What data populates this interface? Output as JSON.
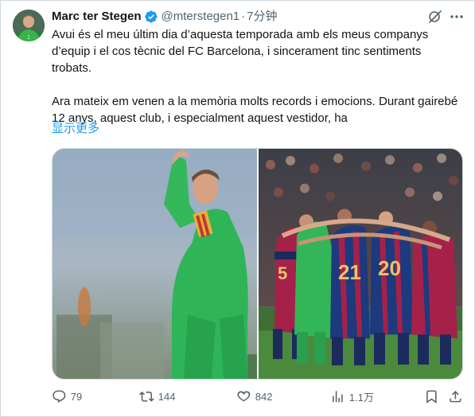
{
  "author": {
    "display_name": "Marc ter Stegen",
    "handle": "@mterstegen1",
    "separator": "·",
    "time": "7分钟",
    "verified": true
  },
  "tweet": {
    "paragraph1": "Avui és el meu últim dia d’aquesta temporada amb els meus companys d’equip i el cos tècnic del FC Barcelona, i sincerament tinc sentiments trobats.",
    "paragraph2": "Ara mateix em venen a la memòria molts records i emocions. Durant gairebé 12 anys, aquest club, i especialment aquest vestidor, ha",
    "show_more": "显示更多"
  },
  "media": {
    "images": [
      {
        "icon": "player-applauding-photo"
      },
      {
        "icon": "team-huddle-photo",
        "jersey_numbers": [
          "5",
          "21",
          "20"
        ]
      }
    ]
  },
  "metrics": {
    "replies": "79",
    "retweets": "144",
    "likes": "842",
    "views": "1.1万"
  },
  "colors": {
    "accent": "#1d9bf0",
    "secondary_text": "#536471",
    "border": "#cfd9de"
  }
}
